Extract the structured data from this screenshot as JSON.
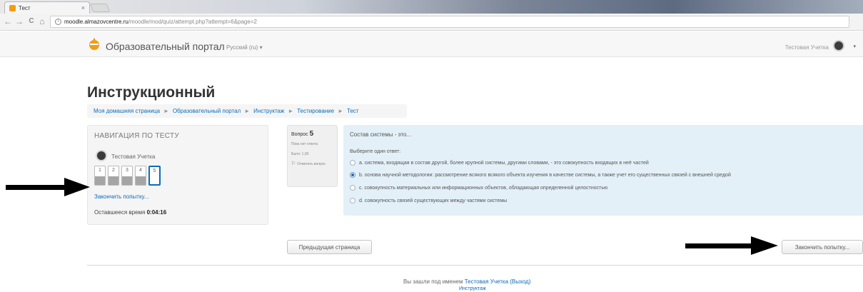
{
  "browser": {
    "tab_title": "Тест",
    "tab_close": "×",
    "url_host": "moodle.almazovcentre.ru",
    "url_path": "/moodle/mod/quiz/attempt.php?attempt=6&page=2",
    "back_glyph": "←",
    "forward_glyph": "→",
    "reload_glyph": "C",
    "home_glyph": "⌂",
    "info_glyph": "i"
  },
  "header": {
    "site_name": "Образовательный портал",
    "language": "Русский (ru) ▾",
    "user_name": "Тестовая Учетка",
    "caret": "▾"
  },
  "page": {
    "course_title": "Инструкционный",
    "breadcrumb": [
      "Моя домашняя страница",
      "Образовательный портал",
      "Инструктаж",
      "Тестирование",
      "Тест"
    ],
    "breadcrumb_sep": "►"
  },
  "quiz_nav": {
    "heading": "НАВИГАЦИЯ ПО ТЕСТУ",
    "user_name": "Тестовая Учетка",
    "questions": [
      "1",
      "2",
      "3",
      "4",
      "5"
    ],
    "current_question": "5",
    "finish_link": "Закончить попытку...",
    "time_label": "Оставшееся время",
    "time_value": "0:04:16"
  },
  "question_info": {
    "label": "Вопрос",
    "number": "5",
    "state": "Пока нет ответа",
    "grade": "Балл: 1,00",
    "flag_label": "Отметить вопрос"
  },
  "question": {
    "text": "Состав системы - это...",
    "prompt": "Выберите один ответ:",
    "answers": [
      "a. система, входящая в состав другой, более крупной системы, другими словами, - это совокупность входящих в неё частей",
      "b. основа научной методологии: рассмотрение всякого всякого объекта изучения в качестве системы, а также учет его существенных связей с внешней средой",
      "c. совокупность материальных или информационных объектов, обладающая определенной целостностью",
      "d. совокупность связей существующих между частями системы"
    ],
    "selected_index": 1
  },
  "buttons": {
    "prev_page": "Предыдущая страница",
    "finish_attempt": "Закончить попытку..."
  },
  "footer": {
    "logged_in_prefix": "Вы зашли под именем",
    "logged_in_user": "Тестовая Учетка",
    "logout": "(Выход)",
    "course_link": "Инструктаж"
  },
  "colors": {
    "accent": "#0a6dba",
    "question_bg": "#e3f0f8",
    "arrow": "#000000",
    "logo": "#f39c12"
  }
}
